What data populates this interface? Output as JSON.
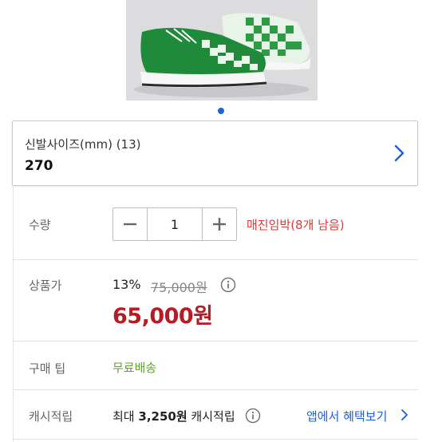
{
  "option": {
    "label": "신발사이즈(mm) (13)",
    "value": "270"
  },
  "quantity": {
    "label": "수량",
    "value": "1",
    "stock_text": "매진임박(8개 남음)"
  },
  "price": {
    "label": "상품가",
    "discount": "13%",
    "original": "75,000원",
    "sale": "65,000원"
  },
  "tip": {
    "label": "구매 팁",
    "value": "무료배송"
  },
  "cashback": {
    "label": "캐시적립",
    "prefix": "최대",
    "amount": "3,250원",
    "suffix": "캐시적립",
    "app_link": "앱에서 혜택보기"
  },
  "colors": {
    "accent_blue": "#1e5fd8",
    "price_red": "#b41c26",
    "stock_red": "#d43b3b",
    "shipping_green": "#5aa62b",
    "shoe_green": "#1f8a3a"
  },
  "icons": [
    "chevron-right-icon",
    "minus-icon",
    "plus-icon",
    "info-icon"
  ]
}
